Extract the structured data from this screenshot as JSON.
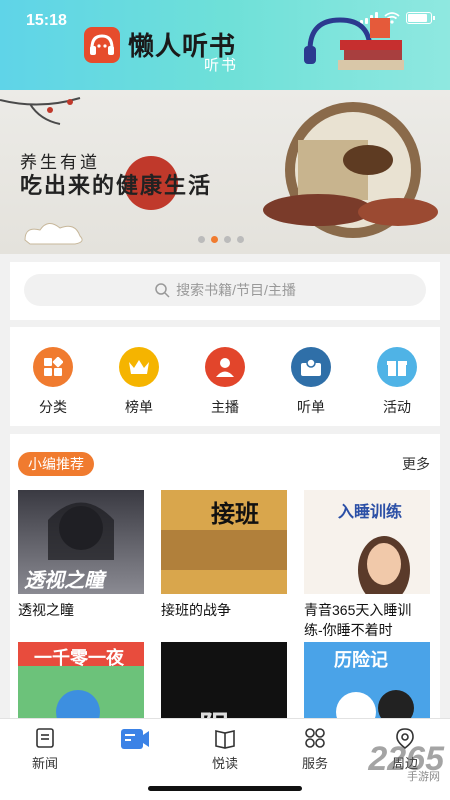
{
  "status_bar": {
    "time": "15:18"
  },
  "header": {
    "app_name": "懒人听书",
    "sub": "听书"
  },
  "banner": {
    "line1": "养生有道",
    "line2": "吃出来的健康生活",
    "active_dot": 1
  },
  "search": {
    "placeholder": "搜索书籍/节目/主播"
  },
  "categories": [
    {
      "label": "分类",
      "icon": "grid-icon",
      "color": "#f07b2f"
    },
    {
      "label": "榜单",
      "icon": "crown-icon",
      "color": "#f5b400"
    },
    {
      "label": "主播",
      "icon": "person-icon",
      "color": "#e2452b"
    },
    {
      "label": "听单",
      "icon": "list-icon",
      "color": "#2f6fa8"
    },
    {
      "label": "活动",
      "icon": "gift-icon",
      "color": "#4fb3e6"
    }
  ],
  "recommend": {
    "title": "小编推荐",
    "more": "更多",
    "books": [
      {
        "title": "透视之瞳",
        "cover_text": "透视之瞳"
      },
      {
        "title": "接班的战争",
        "cover_text": "接班"
      },
      {
        "title": "青音365天入睡训练-你睡不着时",
        "cover_text": "入睡训练"
      },
      {
        "title": "",
        "cover_text": "一千零一夜"
      },
      {
        "title": "",
        "cover_text": "阴"
      },
      {
        "title": "",
        "cover_text": "历险记"
      }
    ]
  },
  "nav": [
    {
      "label": "新闻",
      "icon": "news-icon",
      "active": false
    },
    {
      "label": "",
      "icon": "listen-icon",
      "active": true
    },
    {
      "label": "悦读",
      "icon": "book-icon",
      "active": false
    },
    {
      "label": "服务",
      "icon": "service-icon",
      "active": false
    },
    {
      "label": "周边",
      "icon": "location-icon",
      "active": false
    }
  ],
  "watermark": {
    "text": "2265",
    "sub": "手游网"
  },
  "colors": {
    "accent": "#f07b2f",
    "active_nav": "#3b82e6"
  }
}
